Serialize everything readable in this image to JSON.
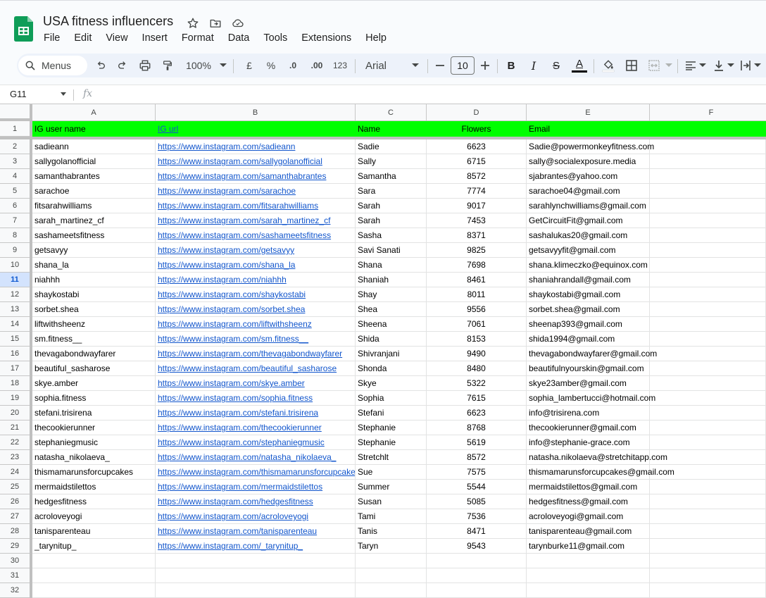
{
  "app": {
    "doc_title": "USA fitness influencers",
    "icons": [
      "star-icon",
      "move-to-folder-icon",
      "cloud-status-icon"
    ],
    "menu": [
      "File",
      "Edit",
      "View",
      "Insert",
      "Format",
      "Data",
      "Tools",
      "Extensions",
      "Help"
    ]
  },
  "toolbar": {
    "menus_label": "Menus",
    "zoom": "100%",
    "currency": "£",
    "percent": "%",
    "decrease_decimal": ".0",
    "increase_decimal": ".00",
    "number_format": "123",
    "font": "Arial",
    "font_size": "10",
    "bold": "B",
    "italic": "I",
    "strikethrough": "S",
    "text_color_letter": "A"
  },
  "formula_bar": {
    "cell_ref": "G11",
    "fx": "fx",
    "content": ""
  },
  "sheet": {
    "columns": [
      "A",
      "B",
      "C",
      "D",
      "E",
      "F"
    ],
    "active_row": 11,
    "header_color": "#00ff00",
    "header_row": [
      "IG user name",
      "IG url",
      "Name",
      "Flowers",
      "Email",
      ""
    ],
    "rows": [
      [
        "sadieann",
        "https://www.instagram.com/sadieann",
        "Sadie",
        "6623",
        "Sadie@powermonkeyfitness.com"
      ],
      [
        "sallygolanofficial",
        "https://www.instagram.com/sallygolanofficial",
        "Sally",
        "6715",
        "sally@socialexposure.media"
      ],
      [
        "samanthabrantes",
        "https://www.instagram.com/samanthabrantes",
        "Samantha",
        "8572",
        "sjabrantes@yahoo.com"
      ],
      [
        "sarachoe",
        "https://www.instagram.com/sarachoe",
        "Sara",
        "7774",
        "sarachoe04@gmail.com"
      ],
      [
        "fitsarahwilliams",
        "https://www.instagram.com/fitsarahwilliams",
        "Sarah",
        "9017",
        "sarahlynchwilliams@gmail.com"
      ],
      [
        "sarah_martinez_cf",
        "https://www.instagram.com/sarah_martinez_cf",
        "Sarah",
        "7453",
        "GetCircuitFit@gmail.com"
      ],
      [
        "sashameetsfitness",
        "https://www.instagram.com/sashameetsfitness",
        "Sasha",
        "8371",
        "sashalukas20@gmail.com"
      ],
      [
        "getsavyy",
        "https://www.instagram.com/getsavyy",
        "Savi Sanati",
        "9825",
        "getsavyyfit@gmail.com"
      ],
      [
        "shana_la",
        "https://www.instagram.com/shana_la",
        "Shana",
        "7698",
        "shana.klimeczko@equinox.com"
      ],
      [
        "niahhh",
        "https://www.instagram.com/niahhh",
        "Shaniah",
        "8461",
        "shaniahrandall@gmail.com"
      ],
      [
        "shaykostabi",
        "https://www.instagram.com/shaykostabi",
        "Shay",
        "8011",
        "shaykostabi@gmail.com"
      ],
      [
        "sorbet.shea",
        "https://www.instagram.com/sorbet.shea",
        "Shea",
        "9556",
        "sorbet.shea@gmail.com"
      ],
      [
        "liftwithsheenz",
        "https://www.instagram.com/liftwithsheenz",
        "Sheena",
        "7061",
        "sheenap393@gmail.com"
      ],
      [
        "sm.fitness__",
        "https://www.instagram.com/sm.fitness__",
        "Shida",
        "8153",
        "shida1994@gmail.com"
      ],
      [
        "thevagabondwayfarer",
        "https://www.instagram.com/thevagabondwayfarer",
        "Shivranjani",
        "9490",
        "thevagabondwayfarer@gmail.com"
      ],
      [
        "beautiful_sasharose",
        "https://www.instagram.com/beautiful_sasharose",
        "Shonda",
        "8480",
        "beautifulnyourskin@gmail.com"
      ],
      [
        "skye.amber",
        "https://www.instagram.com/skye.amber",
        "Skye",
        "5322",
        "skye23amber@gmail.com"
      ],
      [
        "sophia.fitness",
        "https://www.instagram.com/sophia.fitness",
        "Sophia",
        "7615",
        "sophia_lambertucci@hotmail.com"
      ],
      [
        "stefani.trisirena",
        "https://www.instagram.com/stefani.trisirena",
        "Stefani",
        "6623",
        "info@trisirena.com"
      ],
      [
        "thecookierunner",
        "https://www.instagram.com/thecookierunner",
        "Stephanie",
        "8768",
        "thecookierunner@gmail.com"
      ],
      [
        "stephaniegmusic",
        "https://www.instagram.com/stephaniegmusic",
        "Stephanie",
        "5619",
        "info@stephanie-grace.com"
      ],
      [
        "natasha_nikolaeva_",
        "https://www.instagram.com/natasha_nikolaeva_",
        "Stretchlt",
        "8572",
        "natasha.nikolaeva@stretchitapp.com"
      ],
      [
        "thismamarunsforcupcakes",
        "https://www.instagram.com/thismamarunsforcupcake",
        "Sue",
        "7575",
        "thismamarunsforcupcakes@gmail.com"
      ],
      [
        "mermaidstilettos",
        "https://www.instagram.com/mermaidstilettos",
        "Summer",
        "5544",
        "mermaidstilettos@gmail.com"
      ],
      [
        "hedgesfitness",
        "https://www.instagram.com/hedgesfitness",
        "Susan",
        "5085",
        "hedgesfitness@gmail.com"
      ],
      [
        "acroloveyogi",
        "https://www.instagram.com/acroloveyogi",
        "Tami",
        "7536",
        "acroloveyogi@gmail.com"
      ],
      [
        "tanisparenteau",
        "https://www.instagram.com/tanisparenteau",
        "Tanis",
        "8471",
        "tanisparenteau@gmail.com"
      ],
      [
        "_tarynitup_",
        "https://www.instagram.com/_tarynitup_",
        "Taryn",
        "9543",
        "tarynburke11@gmail.com"
      ],
      [
        "",
        "",
        "",
        "",
        ""
      ],
      [
        "",
        "",
        "",
        "",
        ""
      ],
      [
        "",
        "",
        "",
        "",
        ""
      ]
    ]
  }
}
